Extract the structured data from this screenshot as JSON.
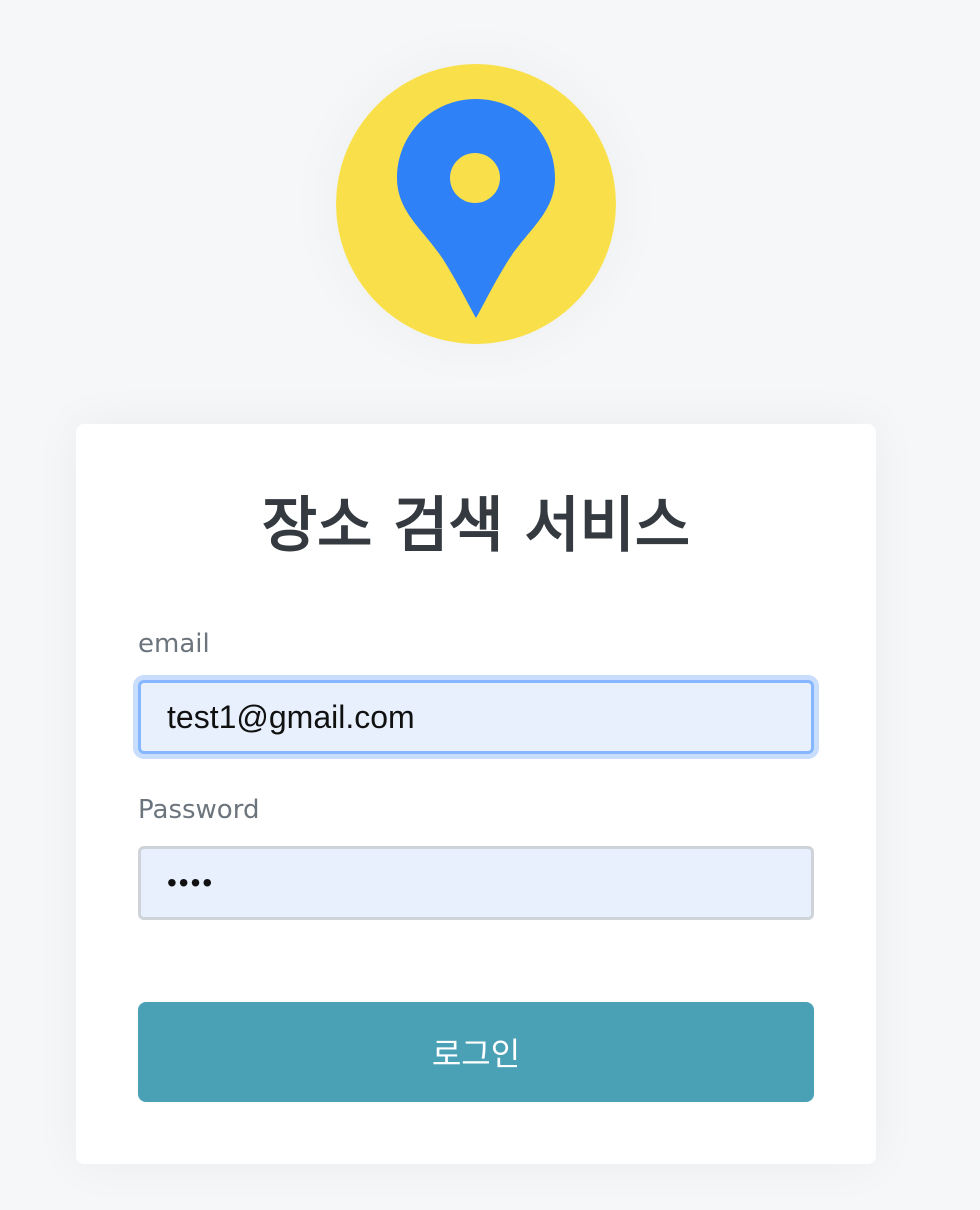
{
  "logo": {
    "icon": "map-pin-icon",
    "background_color": "#f9e04b",
    "pin_color": "#2f81f7"
  },
  "card": {
    "title": "장소 검색 서비스",
    "email": {
      "label": "email",
      "value": "test1@gmail.com"
    },
    "password": {
      "label": "Password",
      "value": "••••"
    },
    "login_button": "로그인"
  },
  "colors": {
    "page_background": "#f6f7f9",
    "button": "#4aa0b5",
    "input_background": "#e8f0fe",
    "focus_border": "#86b7fe",
    "title_text": "#343a40",
    "label_text": "#6c757d"
  }
}
